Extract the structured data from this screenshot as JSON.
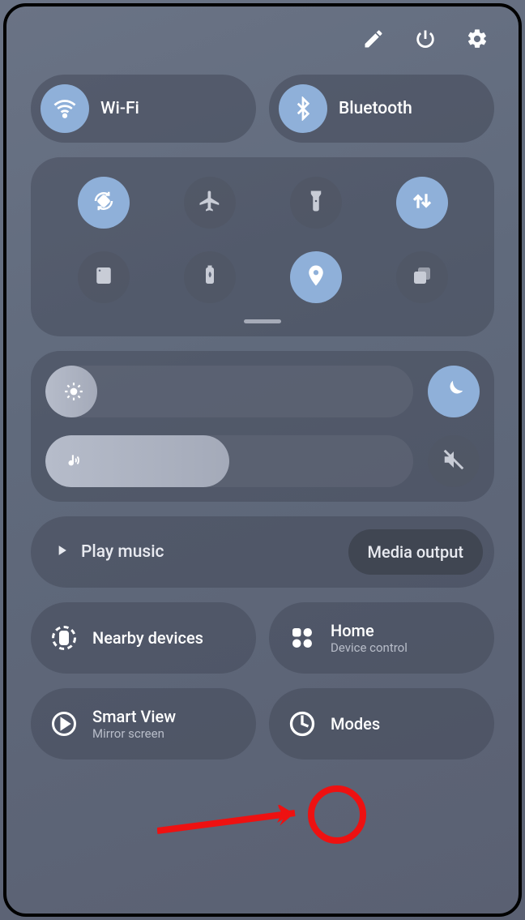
{
  "header": {
    "edit_icon": "pencil-icon",
    "power_icon": "power-icon",
    "settings_icon": "gear-icon"
  },
  "primary_toggles": {
    "wifi": {
      "label": "Wi-Fi",
      "active": true
    },
    "bluetooth": {
      "label": "Bluetooth",
      "active": true
    }
  },
  "quick_toggles": [
    {
      "name": "auto-rotate",
      "active": true
    },
    {
      "name": "airplane-mode",
      "active": false
    },
    {
      "name": "flashlight",
      "active": false
    },
    {
      "name": "mobile-data",
      "active": true
    },
    {
      "name": "screen-cast",
      "active": false
    },
    {
      "name": "battery-saver",
      "active": false
    },
    {
      "name": "location",
      "active": true
    },
    {
      "name": "multi-window",
      "active": false
    }
  ],
  "sliders": {
    "brightness": {
      "percent": 14,
      "dark_mode_active": true
    },
    "volume": {
      "percent": 50,
      "muted": true
    }
  },
  "media": {
    "play_label": "Play music",
    "output_label": "Media output"
  },
  "bottom_buttons": {
    "nearby": {
      "title": "Nearby devices"
    },
    "home": {
      "title": "Home",
      "sub": "Device control"
    },
    "smartview": {
      "title": "Smart View",
      "sub": "Mirror screen"
    },
    "modes": {
      "title": "Modes"
    }
  }
}
